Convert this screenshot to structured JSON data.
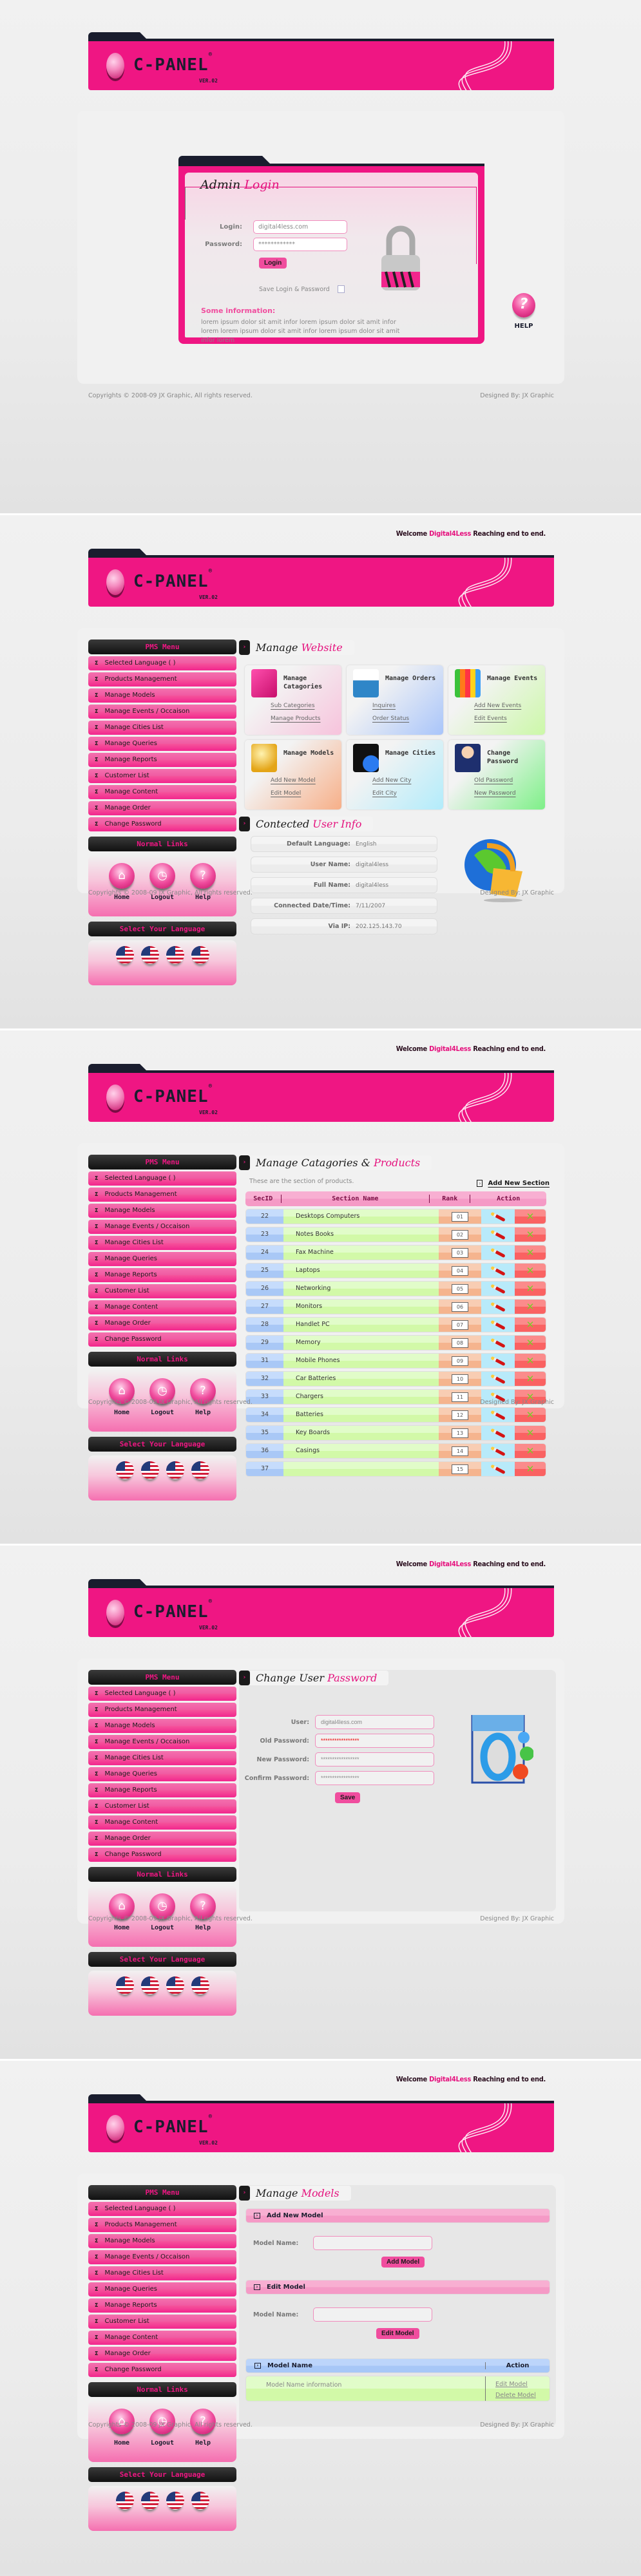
{
  "brand": {
    "logo": "C-PANEL",
    "registered": "®",
    "version": "VER.02"
  },
  "welcome": {
    "prefix": "Welcome",
    "user": "Digital4Less",
    "suffix": "Reaching end to end."
  },
  "footer": {
    "copyright": "Copyrights © 2008-09 JX Graphic, All rights reserved.",
    "designed_by": "Designed By: JX Graphic"
  },
  "login_page": {
    "title_a": "Admin",
    "title_b": "Login",
    "login_label": "Login:",
    "login_value": "digital4less.com",
    "password_label": "Password:",
    "password_value": "************",
    "login_button": "Login",
    "save_label": "Save Login & Password",
    "info_heading": "Some information:",
    "info_text": "lorem ipsum dolor sit amit infor lorem ipsum dolor sit amit infor lorem lorem ipsum dolor sit amit infor lorem ipsum dolor sit amit infor lorem",
    "help_label": "HELP",
    "help_icon": "question-mark-icon"
  },
  "sidebar": {
    "menu_title": "PMS Menu",
    "items": [
      {
        "label": "Selected Language ( )"
      },
      {
        "label": "Products Management"
      },
      {
        "label": "Manage Models"
      },
      {
        "label": "Manage Events / Occaison"
      },
      {
        "label": "Manage Cities List"
      },
      {
        "label": "Manage Queries"
      },
      {
        "label": "Manage Reports"
      },
      {
        "label": "Customer List"
      },
      {
        "label": "Manage Content"
      },
      {
        "label": "Manage Order"
      },
      {
        "label": "Change Password"
      }
    ],
    "normal_links_title": "Normal Links",
    "normal_links": [
      {
        "label": "Home",
        "icon": "house-icon"
      },
      {
        "label": "Logout",
        "icon": "clock-icon"
      },
      {
        "label": "Help",
        "icon": "question-mark-icon"
      }
    ],
    "language_title": "Select Your Language",
    "languages": [
      "us-flag-icon",
      "us-flag-icon",
      "us-flag-icon",
      "us-flag-icon"
    ]
  },
  "dashboard": {
    "title_a": "Manage",
    "title_b": "Website",
    "tiles": [
      {
        "title": "Manage Catagories",
        "icon": "book-icon",
        "links": [
          "Sub Categories",
          "Manage Products"
        ],
        "color": "#f7c3dc"
      },
      {
        "title": "Manage Orders",
        "icon": "inbox-pencil-icon",
        "links": [
          "Inquires",
          "Order Status"
        ],
        "color": "#a9c5fa"
      },
      {
        "title": "Manage Events",
        "icon": "pencil-cup-icon",
        "links": [
          "Add New Events",
          "Edit Events"
        ],
        "color": "#ccf8a8"
      },
      {
        "title": "Manage Models",
        "icon": "apple-icon",
        "links": [
          "Add New Model",
          "Edit Model"
        ],
        "color": "#f7af88"
      },
      {
        "title": "Manage Cities",
        "icon": "folder-globe-icon",
        "links": [
          "Add New City",
          "Edit City"
        ],
        "color": "#b2ecfb"
      },
      {
        "title": "Change Password",
        "icon": "user-icon",
        "links": [
          "Old Password",
          "New Password"
        ],
        "color": "#7ef088"
      }
    ],
    "user_info_title_a": "Contected",
    "user_info_title_b": "User Info",
    "user_info": [
      {
        "label": "Default Language:",
        "value": "English"
      },
      {
        "label": "User Name:",
        "value": "digital4less"
      },
      {
        "label": "Full Name:",
        "value": "digital4less"
      },
      {
        "label": "Connected Date/Time:",
        "value": "7/11/2007"
      },
      {
        "label": "Via IP:",
        "value": "202.125.143.70"
      }
    ]
  },
  "categories": {
    "title_a": "Manage Catagories &",
    "title_b": "Products",
    "note": "These are the section of products.",
    "add_link": "Add New Section",
    "columns": [
      "SecID",
      "Section Name",
      "Rank",
      "Action"
    ],
    "rows": [
      {
        "id": "22",
        "name": "Desktops Computers",
        "rank": "01"
      },
      {
        "id": "23",
        "name": "Notes Books",
        "rank": "02"
      },
      {
        "id": "24",
        "name": "Fax Machine",
        "rank": "03"
      },
      {
        "id": "25",
        "name": "Laptops",
        "rank": "04"
      },
      {
        "id": "26",
        "name": "Networking",
        "rank": "05"
      },
      {
        "id": "27",
        "name": "Monitors",
        "rank": "06"
      },
      {
        "id": "28",
        "name": "Handlet PC",
        "rank": "07"
      },
      {
        "id": "29",
        "name": "Memory",
        "rank": "08"
      },
      {
        "id": "31",
        "name": "Mobile Phones",
        "rank": "09"
      },
      {
        "id": "32",
        "name": "Car Batteries",
        "rank": "10"
      },
      {
        "id": "33",
        "name": "Chargers",
        "rank": "11"
      },
      {
        "id": "34",
        "name": "Batteries",
        "rank": "12"
      },
      {
        "id": "35",
        "name": "Key Boards",
        "rank": "13"
      },
      {
        "id": "36",
        "name": "Casings",
        "rank": "14"
      },
      {
        "id": "37",
        "name": "",
        "rank": "15"
      }
    ]
  },
  "change_password": {
    "title_a": "Change User",
    "title_b": "Password",
    "fields": [
      {
        "label": "User:",
        "value": "digital4less.com"
      },
      {
        "label": "Old Password:",
        "value": "*****************"
      },
      {
        "label": "New Password:",
        "value": "*****************"
      },
      {
        "label": "Confirm Password:",
        "value": "*****************"
      }
    ],
    "save_button": "Save"
  },
  "models": {
    "title_a": "Manage",
    "title_b": "Models",
    "add_heading": "Add New Model",
    "model_name_label": "Model Name:",
    "add_button": "Add Model",
    "edit_heading": "Edit Model",
    "edit_button": "Edit Model",
    "table_col1": "Model Name",
    "table_col2": "Action",
    "row_name": "Model Name information",
    "row_actions": [
      "Edit Model",
      "Delete Model"
    ]
  }
}
